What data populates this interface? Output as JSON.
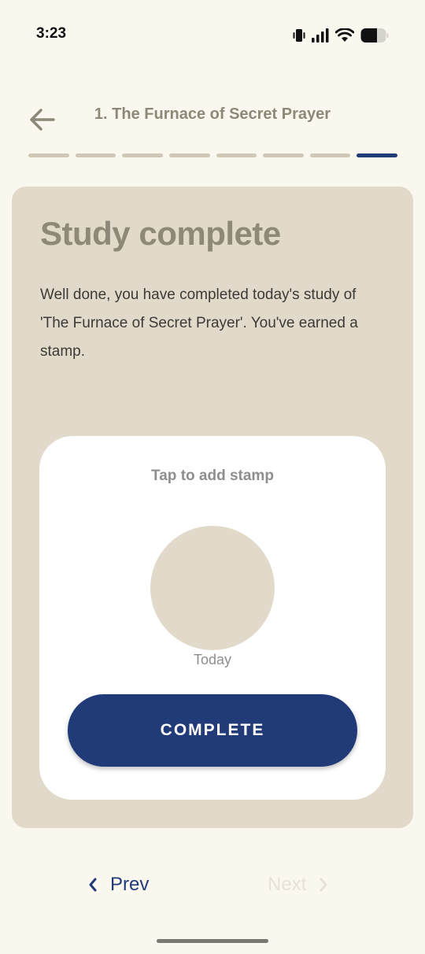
{
  "status_bar": {
    "time": "3:23",
    "icons": [
      "vibrate-icon",
      "signal-icon",
      "wifi-icon",
      "battery-icon"
    ]
  },
  "header": {
    "title": "1. The Furnace of Secret Prayer",
    "back_icon": "arrow-left-icon"
  },
  "progress": {
    "total_steps": 8,
    "current_step": 8
  },
  "card": {
    "title": "Study complete",
    "body": "Well done, you have completed today's study of 'The Furnace of Secret Prayer'. You've earned a stamp."
  },
  "stamp": {
    "prompt": "Tap to add stamp",
    "date_label": "Today"
  },
  "complete_button": {
    "label": "COMPLETE"
  },
  "nav": {
    "prev_label": "Prev",
    "next_label": "Next"
  },
  "colors": {
    "background": "#faf7ef",
    "card": "#e1dacb",
    "accent": "#213b78",
    "muted_text": "#8d8878"
  }
}
